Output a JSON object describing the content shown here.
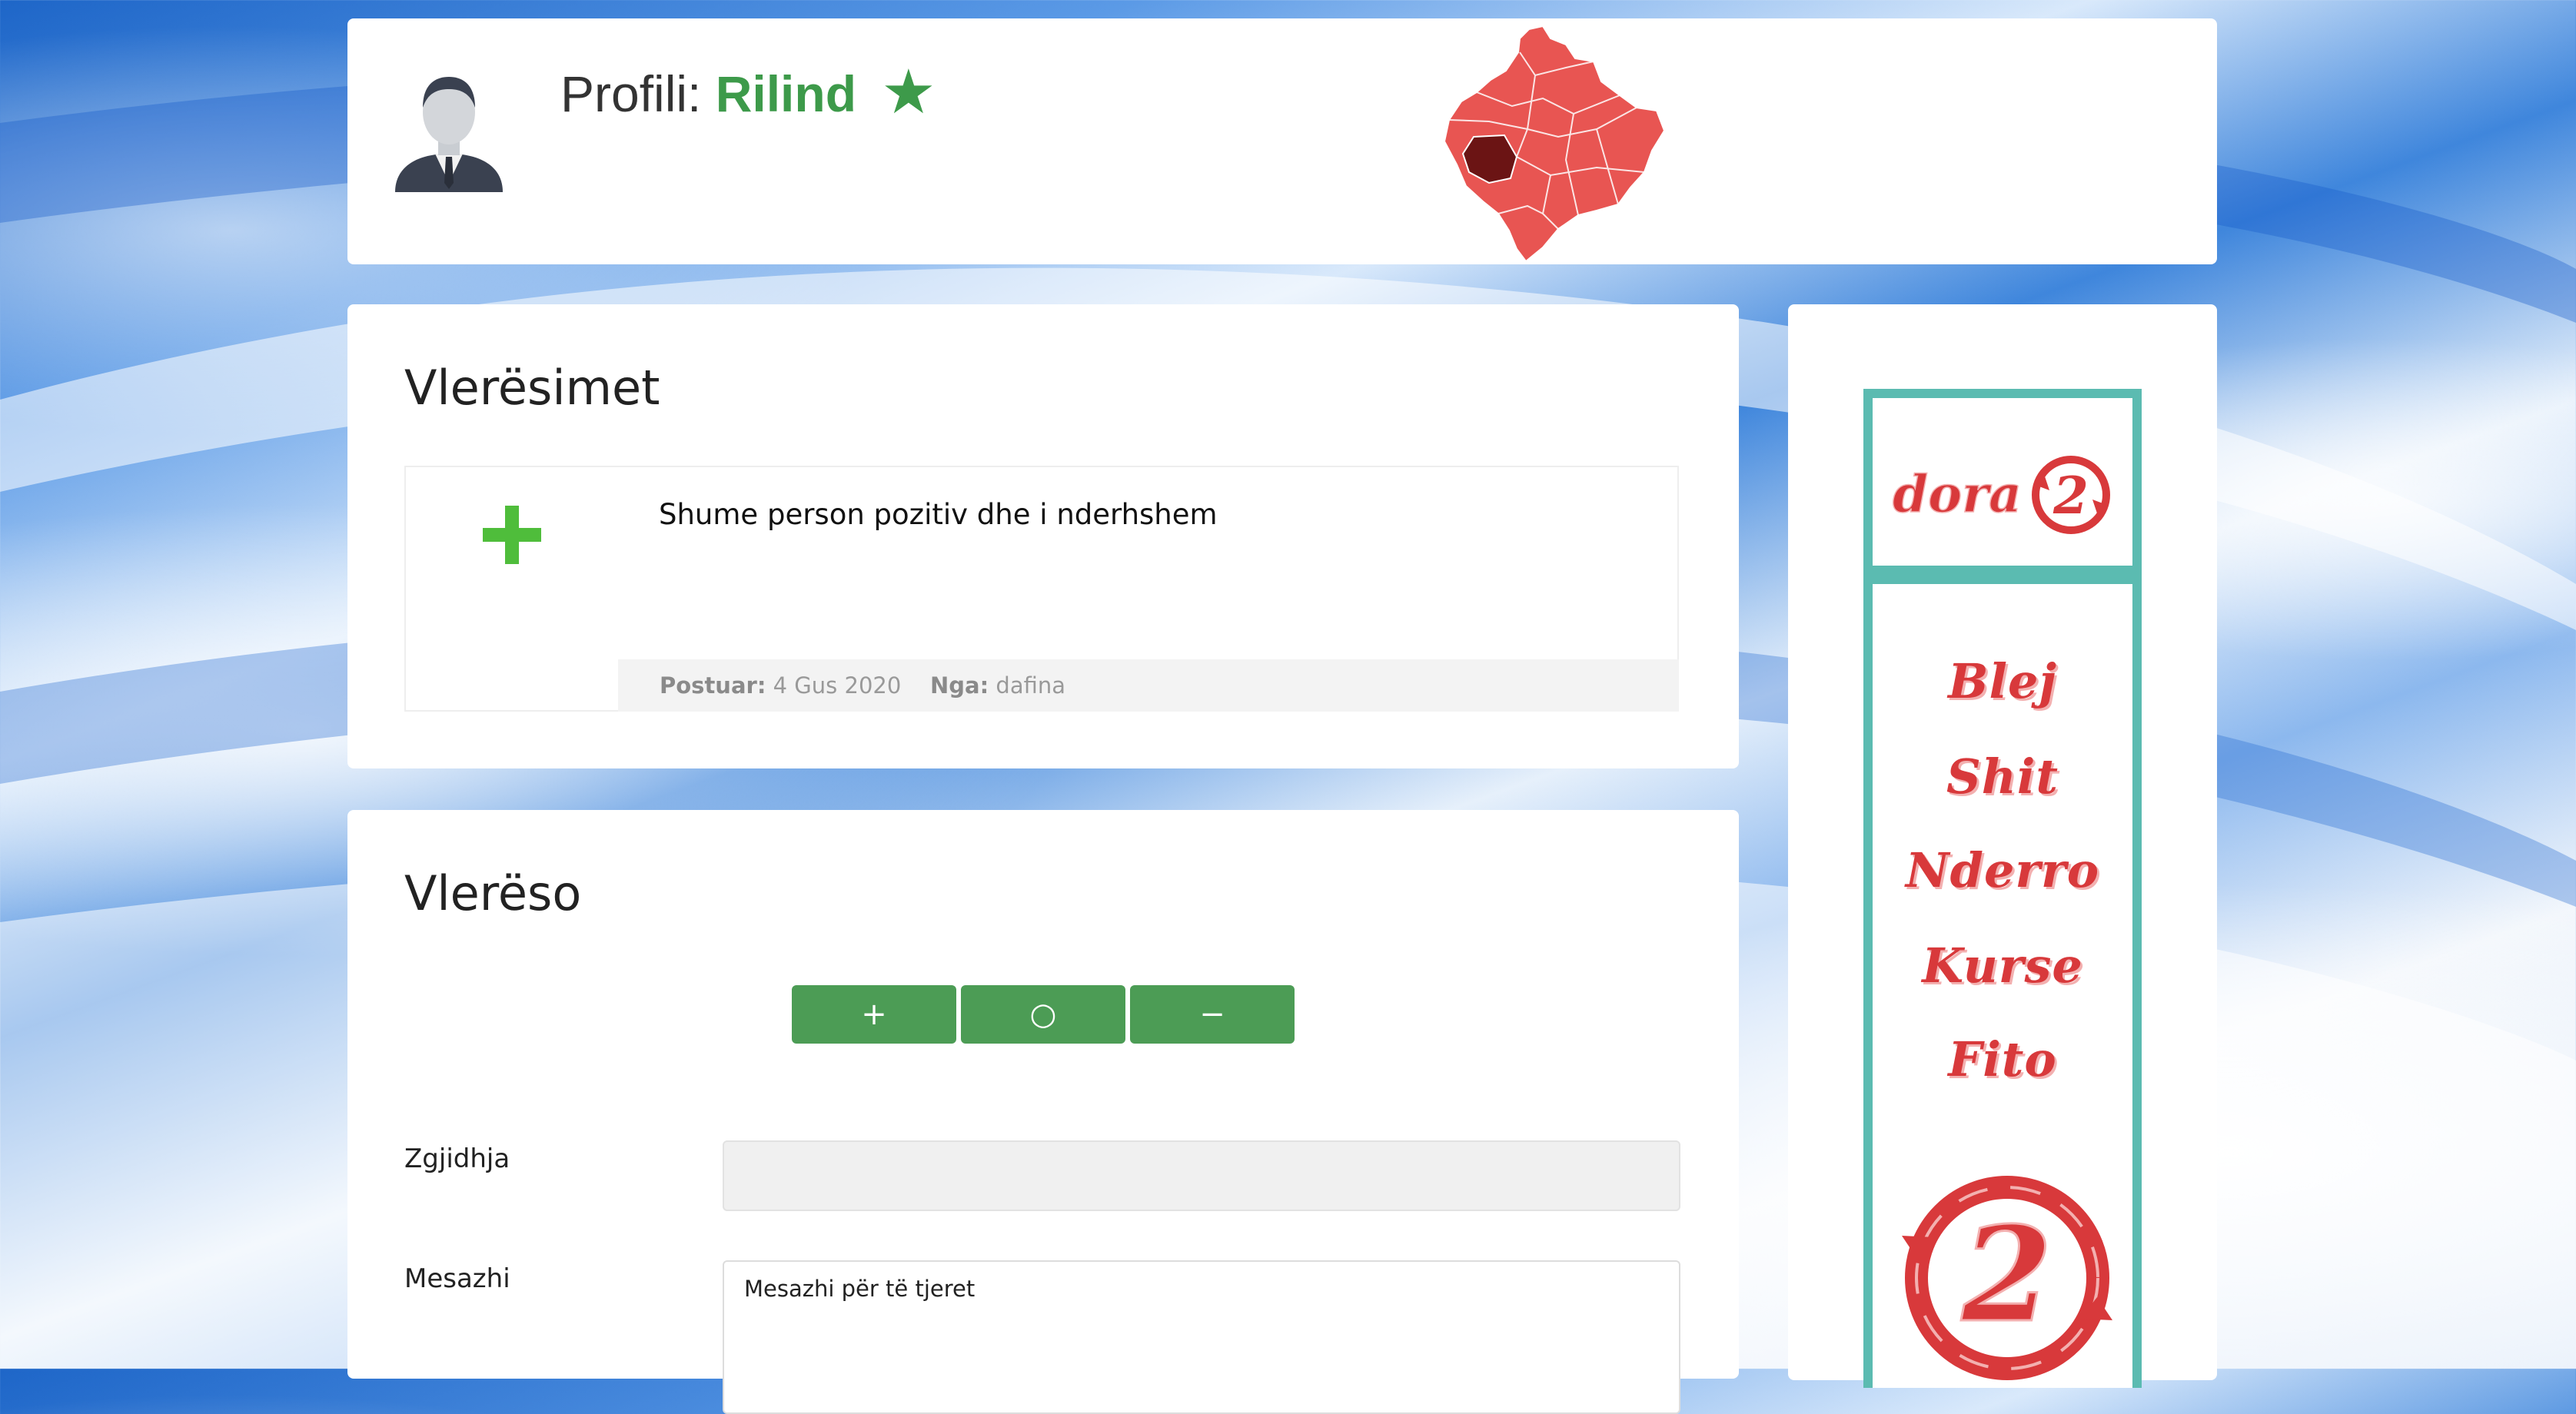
{
  "header": {
    "title_prefix": "Profili:",
    "username": "Rilind",
    "star": "★"
  },
  "ratings": {
    "title": "Vlerësimet",
    "items": [
      {
        "type": "plus",
        "text": "Shume person pozitiv dhe i nderhshem",
        "posted_label": "Postuar:",
        "posted_value": "4 Gus 2020",
        "from_label": "Nga:",
        "from_value": "dafina"
      }
    ]
  },
  "rate": {
    "title": "Vlerëso",
    "buttons": [
      "+",
      "○",
      "−"
    ],
    "choice_label": "Zgjidhja",
    "choice_value": "",
    "message_label": "Mesazhi",
    "message_placeholder": "Mesazhi për të tjeret"
  },
  "ad": {
    "logo_text": "dora",
    "logo_number": "2",
    "words": [
      "Blej",
      "Shit",
      "Nderro",
      "Kurse",
      "Fito"
    ]
  },
  "colors": {
    "accent_green": "#3d9a4a",
    "button_green": "#4c9c55",
    "plus_green": "#4fbd3b",
    "ad_teal": "#5bbbb1",
    "ad_red": "#d8393b",
    "map_red": "#e85552",
    "map_highlight": "#6b1414"
  },
  "icons": [
    "avatar-icon",
    "star-icon",
    "kosovo-map-icon",
    "plus-icon",
    "dora2-logo-icon"
  ]
}
